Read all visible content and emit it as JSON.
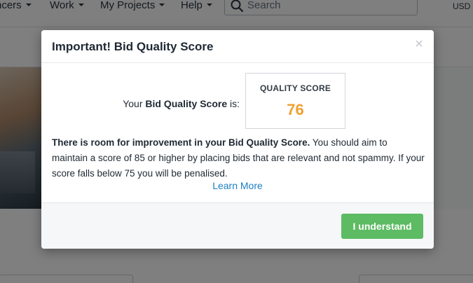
{
  "nav": {
    "items": [
      {
        "label": "ncers"
      },
      {
        "label": "Work"
      },
      {
        "label": "My Projects"
      },
      {
        "label": "Help"
      }
    ],
    "search": {
      "placeholder": "Search",
      "icon": "search-icon"
    },
    "currency": "USD"
  },
  "modal": {
    "title": "Important! Bid Quality Score",
    "close_glyph": "×",
    "score_label_prefix": "Your ",
    "score_label_bold": "Bid Quality Score",
    "score_label_suffix": " is:",
    "score_box_title": "QUALITY SCORE",
    "score_value": "76",
    "score_value_color": "#f0a030",
    "message_bold": "There is room for improvement in your Bid Quality Score.",
    "message_rest": " You should aim to maintain a score of 85 or higher by placing bids that are relevant and not spammy. If your score falls below 75 you will be penalised.",
    "learn_more": "Learn More",
    "confirm_button": "I understand",
    "confirm_color": "#5dbb63",
    "link_color": "#1b7fc4"
  }
}
